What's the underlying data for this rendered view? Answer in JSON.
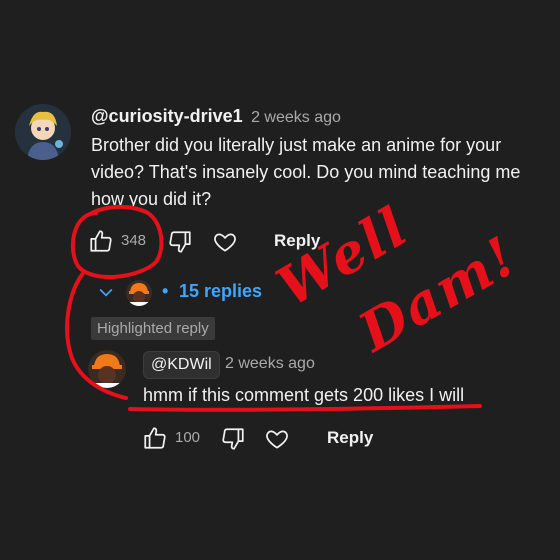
{
  "comment": {
    "author": "@curiosity-drive1",
    "time": "2 weeks ago",
    "text_line1": "Brother did you literally just make an anime for your",
    "text_line2": "video? That's insanely cool. Do you mind teaching me",
    "text_line3": "how you did it?",
    "likes": "348",
    "reply_label": "Reply"
  },
  "replies_summary": {
    "bullet": "•",
    "label": "15 replies"
  },
  "highlighted_badge": "Highlighted reply",
  "reply": {
    "author": "@KDWil",
    "time": "2 weeks ago",
    "text": "hmm if this comment gets 200 likes I will",
    "likes": "100",
    "reply_label": "Reply"
  },
  "annotation": {
    "line1": "Well",
    "line2": "Dam!",
    "color": "#e5101a"
  },
  "icons": [
    "like-icon",
    "dislike-icon",
    "heart-icon",
    "chevron-down-icon"
  ],
  "colors": {
    "background": "#1f1f1f",
    "link": "#3ea6ff",
    "annotation": "#e5101a"
  }
}
